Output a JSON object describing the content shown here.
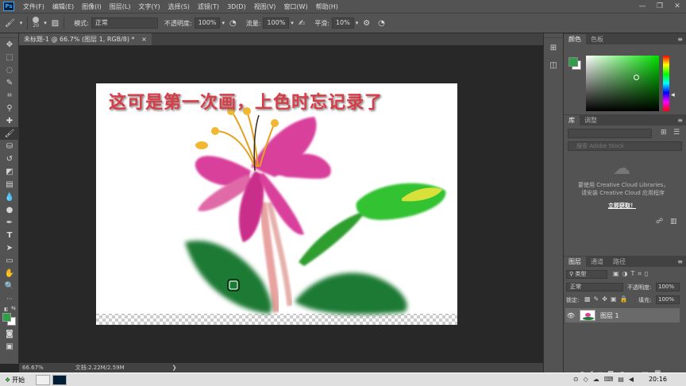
{
  "menu": {
    "app_icon": "Ps",
    "items": [
      "文件(F)",
      "编辑(E)",
      "图像(I)",
      "图层(L)",
      "文字(Y)",
      "选择(S)",
      "滤镜(T)",
      "3D(D)",
      "视图(V)",
      "窗口(W)",
      "帮助(H)"
    ]
  },
  "window_controls": {
    "minimize": "—",
    "restore": "❐",
    "close": "✕"
  },
  "options": {
    "brush_size": "20",
    "mode_label": "模式:",
    "mode_value": "正常",
    "opacity_label": "不透明度:",
    "opacity_value": "100%",
    "flow_label": "流量:",
    "flow_value": "100%",
    "smooth_label": "平滑:",
    "smooth_value": "10%"
  },
  "document": {
    "tab_label": "未标题-1 @ 66.7% (图层 1, RGB/8) *",
    "tab_close": "×",
    "canvas_text": "这可是第一次画，上色时忘记录了"
  },
  "status": {
    "zoom": "66.67%",
    "doc_size": "文档:2.22M/2.59M",
    "arrow": "❯"
  },
  "color_panel": {
    "tabs": [
      "颜色",
      "色板"
    ],
    "fg_color": "#2e9e47",
    "bg_color": "#ffffff"
  },
  "libraries_panel": {
    "tabs": [
      "库",
      "调整"
    ],
    "search_placeholder": "搜索 Adobe Stock",
    "message_line1": "要使用 Creative Cloud Libraries，",
    "message_line2": "请安装 Creative Cloud 应用程序",
    "link": "立即获取！"
  },
  "layers_panel": {
    "tabs": [
      "图层",
      "通道",
      "路径"
    ],
    "filter_label": "类型",
    "blend_mode": "正常",
    "opacity_label": "不透明度:",
    "opacity_value": "100%",
    "lock_label": "锁定:",
    "fill_label": "填充:",
    "fill_value": "100%",
    "layers": [
      {
        "name": "图层 1",
        "visible": true
      }
    ]
  },
  "taskbar": {
    "start_label": "开始",
    "clock": "20:16"
  }
}
